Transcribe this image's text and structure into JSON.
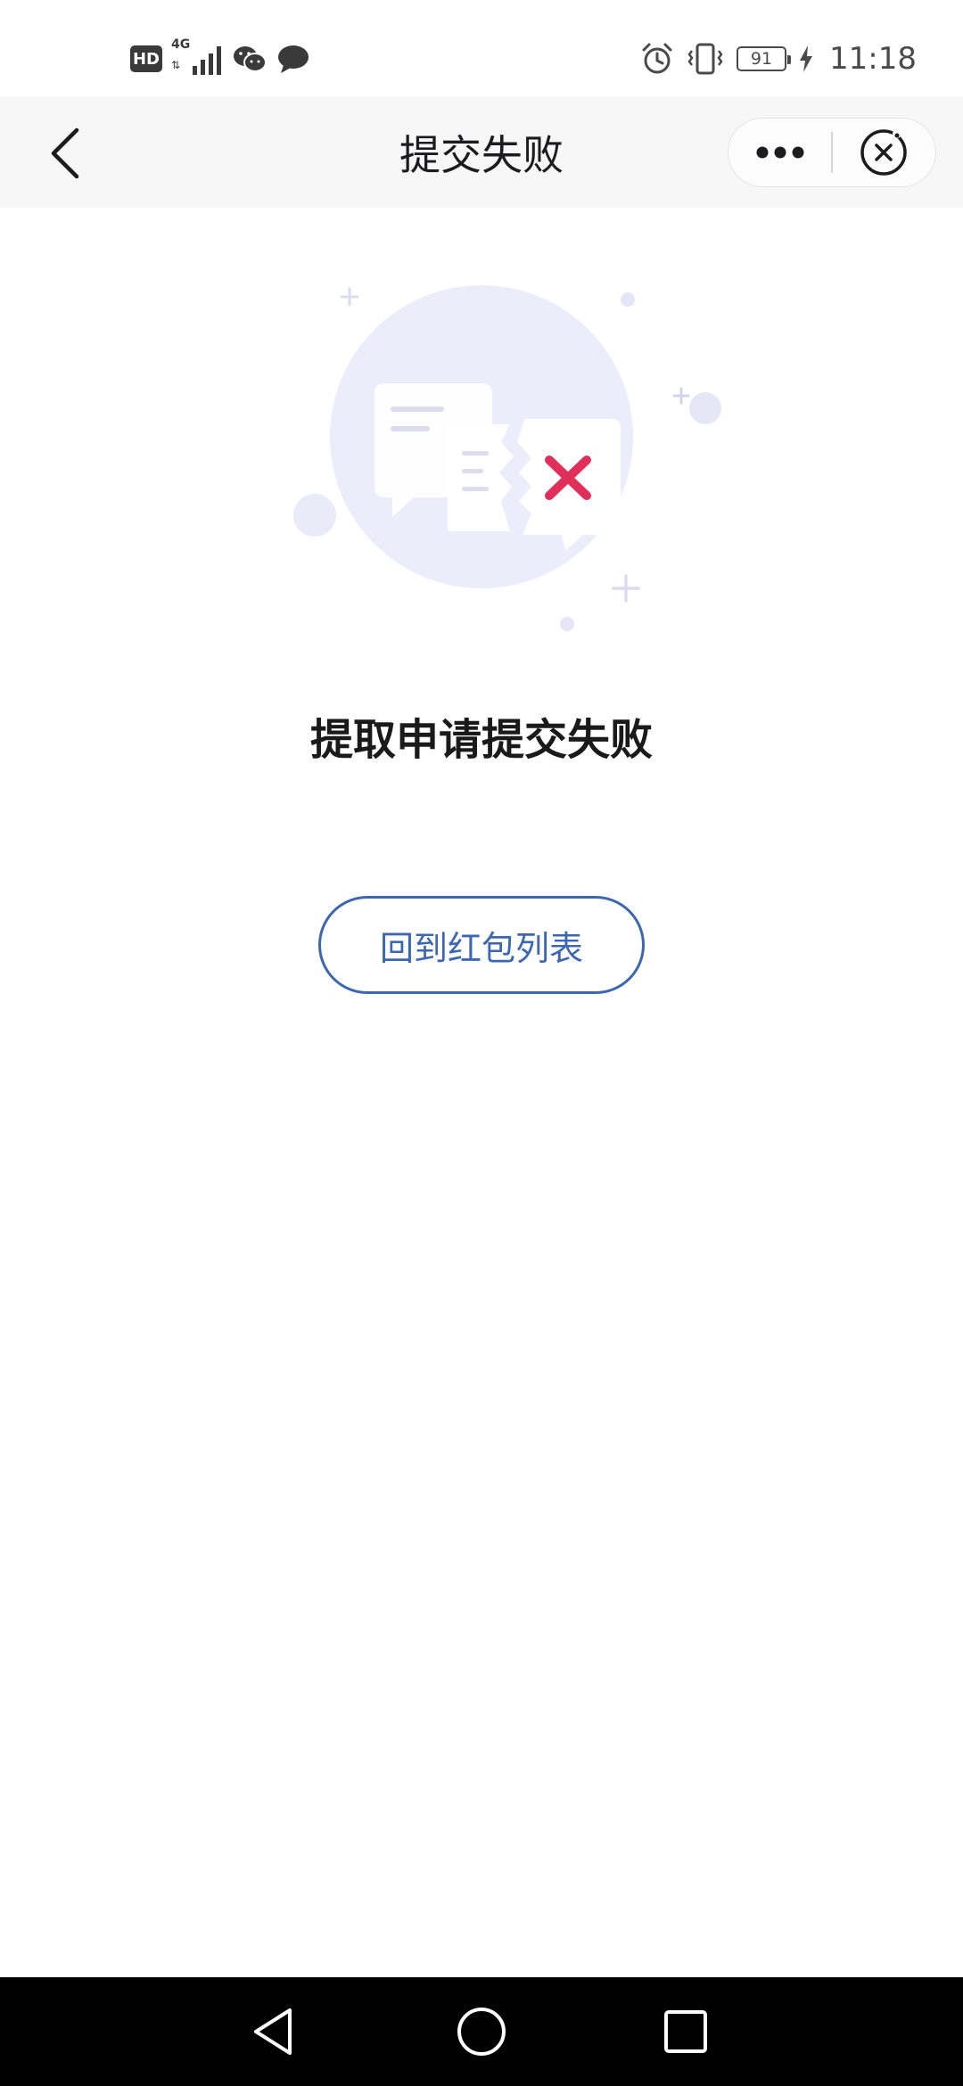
{
  "status_bar": {
    "hd_label": "HD",
    "network_label": "4G",
    "battery_level": "91",
    "time": "11:18",
    "icons": [
      "hd-icon",
      "signal-icon",
      "wechat-icon",
      "message-icon",
      "alarm-icon",
      "vibrate-icon",
      "battery-icon",
      "charging-icon"
    ]
  },
  "nav_bar": {
    "title": "提交失败",
    "back_icon": "chevron-left-icon",
    "more_icon": "more-dots-icon",
    "close_icon": "close-circle-icon"
  },
  "main": {
    "illustration": "submit-failed-illustration",
    "result_title": "提取申请提交失败",
    "back_button_label": "回到红包列表"
  },
  "system_nav": {
    "icons": [
      "back-triangle-icon",
      "home-circle-icon",
      "recents-square-icon"
    ]
  },
  "colors": {
    "accent": "#3d66b3",
    "error": "#e0305a",
    "illustration_bg": "#ececfb",
    "nav_bg": "#f7f7f7"
  }
}
